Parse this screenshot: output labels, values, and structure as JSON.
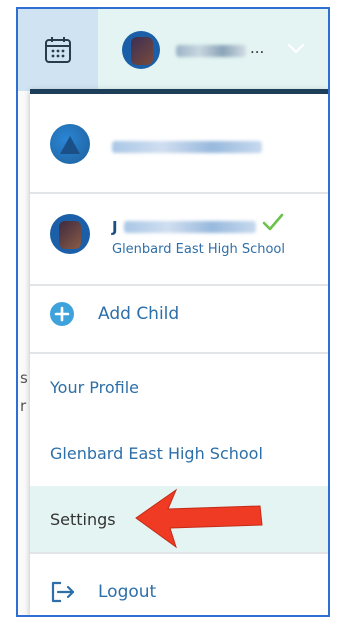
{
  "header": {
    "calendar_icon": "calendar-icon",
    "user_name_suffix": "..."
  },
  "children": [
    {
      "name_initial": "",
      "school": ""
    },
    {
      "name_initial": "J",
      "school": "Glenbard East High School",
      "active": true
    }
  ],
  "menu": {
    "add_child": "Add Child",
    "your_profile": "Your Profile",
    "school": "Glenbard East High School",
    "settings": "Settings",
    "logout": "Logout"
  },
  "colors": {
    "accent": "#2d6fa8",
    "header_bg": "#e3f4f2",
    "calendar_bg": "#cfe3f2",
    "check_green": "#6ac24b",
    "arrow_red": "#ef3b24"
  }
}
